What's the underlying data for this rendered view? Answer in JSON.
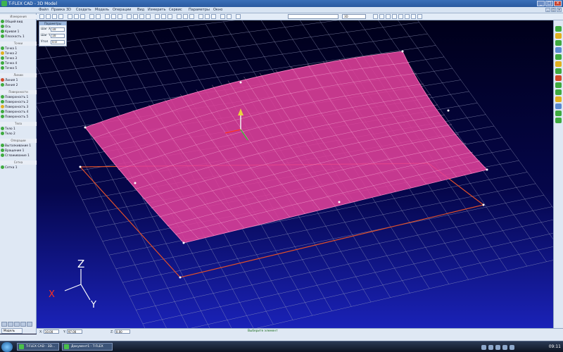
{
  "window": {
    "title": "T-FLEX CAD - 3D Model"
  },
  "menu": {
    "items": [
      "Файл",
      "Правка",
      "3D",
      "Создать",
      "Модель",
      "Операции",
      "Вид",
      "Измерить",
      "Сервис",
      "Параметры",
      "Окно"
    ]
  },
  "toolbar": {
    "view_label": "3D"
  },
  "sidebar": {
    "groups": [
      {
        "header": "Измерения",
        "rows": [
          {
            "icon": "g",
            "label": "Общий вид"
          },
          {
            "icon": "g",
            "label": "Ось"
          },
          {
            "icon": "g",
            "label": "Кривая 1"
          },
          {
            "icon": "g",
            "label": "Плоскость 1"
          }
        ]
      },
      {
        "header": "Точки",
        "rows": [
          {
            "icon": "g",
            "label": "Точка 1"
          },
          {
            "icon": "y",
            "label": "Точка 2"
          },
          {
            "icon": "g",
            "label": "Точка 3"
          },
          {
            "icon": "g",
            "label": "Точка 4"
          },
          {
            "icon": "g",
            "label": "Точка 5"
          }
        ]
      },
      {
        "header": "Линии",
        "rows": [
          {
            "icon": "r",
            "label": "Линия 1"
          },
          {
            "icon": "g",
            "label": "Линия 2"
          }
        ]
      },
      {
        "header": "Поверхности",
        "rows": [
          {
            "icon": "g",
            "label": "Поверхность 1"
          },
          {
            "icon": "g",
            "label": "Поверхность 2"
          },
          {
            "icon": "y",
            "label": "Поверхность 3"
          },
          {
            "icon": "g",
            "label": "Поверхность 4"
          },
          {
            "icon": "g",
            "label": "Поверхность 5"
          }
        ]
      },
      {
        "header": "Тела",
        "rows": [
          {
            "icon": "g",
            "label": "Тело 1"
          },
          {
            "icon": "g",
            "label": "Тело 2"
          }
        ]
      },
      {
        "header": "Операции",
        "rows": [
          {
            "icon": "g",
            "label": "Выталкивание 1"
          },
          {
            "icon": "g",
            "label": "Вращение 1"
          },
          {
            "icon": "g",
            "label": "Сглаживание 1"
          }
        ]
      },
      {
        "header": "Сетка",
        "rows": [
          {
            "icon": "g",
            "label": "Сетка 1"
          }
        ]
      }
    ],
    "bottom_tab": "Модель"
  },
  "param_box": {
    "title": "Параметры",
    "rows": [
      {
        "label": "Шаг X",
        "value": "10"
      },
      {
        "label": "Шаг Y",
        "value": "10"
      },
      {
        "label": "Угол",
        "value": "0.0"
      }
    ]
  },
  "axes": {
    "z": "Z",
    "x": "X",
    "y": "Y"
  },
  "statusbar": {
    "fields": [
      {
        "label": "X:",
        "value": "10.00"
      },
      {
        "label": "Y:",
        "value": "97.00"
      },
      {
        "label": "Z:",
        "value": "0.00"
      }
    ],
    "center_text": "Выберите элемент"
  },
  "taskbar": {
    "tasks": [
      "T-FLEX CAD - 3D...",
      "Документ1 - T-FLEX"
    ],
    "clock": "09:11"
  },
  "colors": {
    "surface": "#e0409a",
    "outline": "#e0502a",
    "grid": "#9aa0c0"
  }
}
